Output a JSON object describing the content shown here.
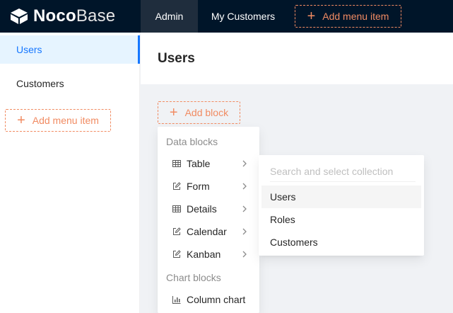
{
  "header": {
    "logo_bold": "Noco",
    "logo_thin": "Base",
    "tabs": [
      {
        "label": "Admin"
      },
      {
        "label": "My Customers"
      }
    ],
    "add_menu_label": "Add menu item"
  },
  "sidebar": {
    "items": [
      {
        "label": "Users"
      },
      {
        "label": "Customers"
      }
    ],
    "add_menu_label": "Add menu item"
  },
  "page": {
    "title": "Users",
    "add_block_label": "Add block"
  },
  "block_menu": {
    "groups": [
      {
        "label": "Data blocks"
      },
      {
        "label": "Chart blocks"
      }
    ],
    "items": [
      {
        "label": "Table",
        "icon": "table-icon"
      },
      {
        "label": "Form",
        "icon": "edit-icon"
      },
      {
        "label": "Details",
        "icon": "table-icon"
      },
      {
        "label": "Calendar",
        "icon": "edit-icon"
      },
      {
        "label": "Kanban",
        "icon": "edit-icon"
      },
      {
        "label": "Column chart",
        "icon": "bar-chart-icon"
      }
    ]
  },
  "collection_menu": {
    "search_placeholder": "Search and select collection",
    "items": [
      {
        "label": "Users"
      },
      {
        "label": "Roles"
      },
      {
        "label": "Customers"
      }
    ]
  },
  "colors": {
    "header_bg": "#001529",
    "accent": "#f18b62",
    "selected": "#1677ff"
  }
}
